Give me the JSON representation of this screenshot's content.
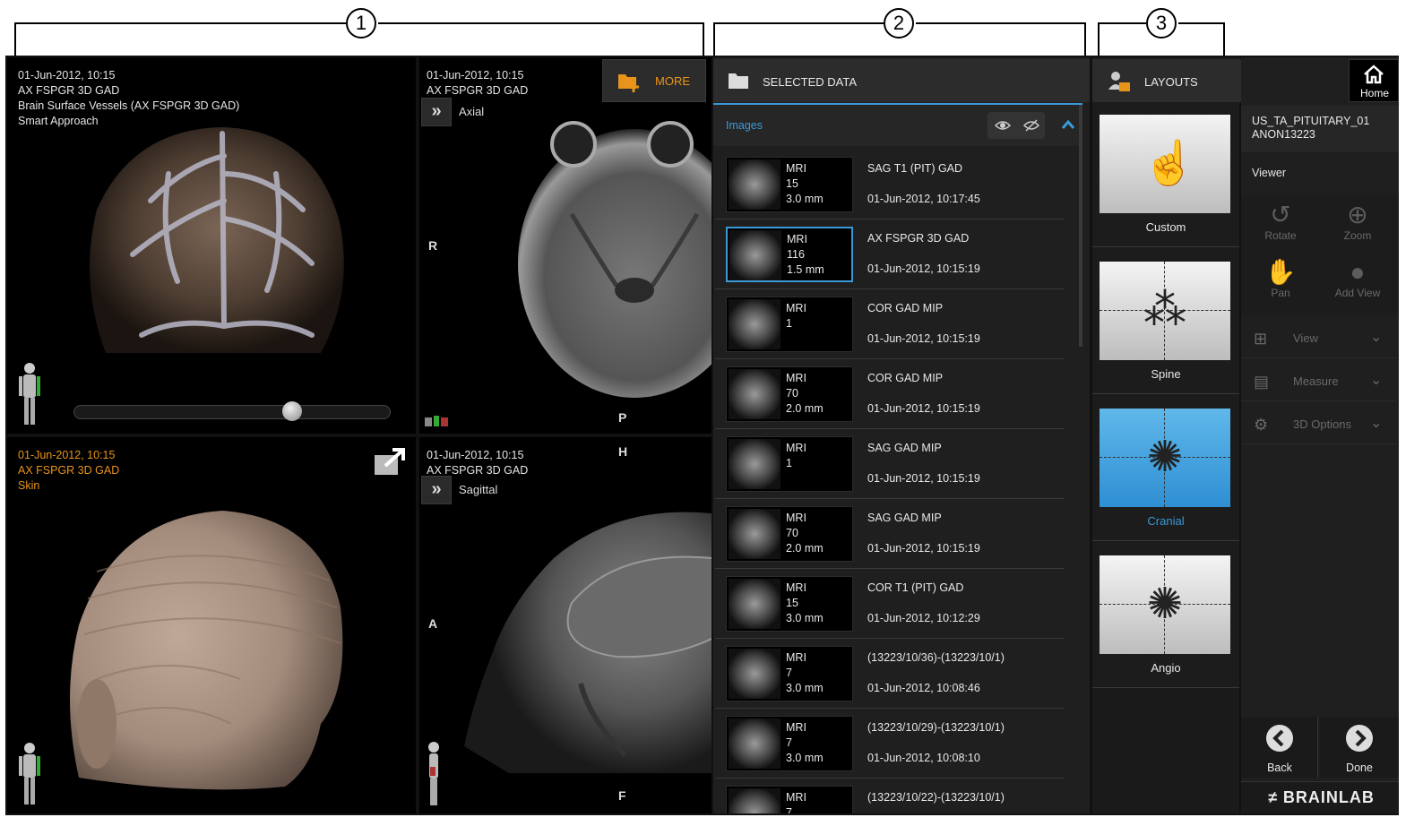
{
  "callouts": [
    "1",
    "2",
    "3"
  ],
  "viewports": {
    "top_left": {
      "date": "01-Jun-2012, 10:15",
      "series": "AX FSPGR 3D GAD",
      "object": "Brain Surface Vessels (AX FSPGR 3D GAD)",
      "mode": "Smart Approach",
      "slider_value": 0.7
    },
    "top_right": {
      "date": "01-Jun-2012, 10:15",
      "series": "AX FSPGR 3D GAD",
      "plane": "Axial",
      "orient_left": "R",
      "orient_bottom": "P",
      "more_label": "MORE"
    },
    "bottom_left": {
      "date": "01-Jun-2012, 10:15",
      "series": "AX FSPGR 3D GAD",
      "object": "Skin"
    },
    "bottom_right": {
      "date": "01-Jun-2012, 10:15",
      "series": "AX FSPGR 3D GAD",
      "plane": "Sagittal",
      "orient_top": "H",
      "orient_left": "A",
      "orient_bottom": "F"
    }
  },
  "selected_data": {
    "title": "SELECTED DATA",
    "section": "Images",
    "rows": [
      {
        "modality": "MRI",
        "count": "15",
        "thickness": "3.0 mm",
        "title": "SAG T1 (PIT) GAD",
        "date": "01-Jun-2012, 10:17:45"
      },
      {
        "modality": "MRI",
        "count": "116",
        "thickness": "1.5 mm",
        "title": "AX FSPGR 3D GAD",
        "date": "01-Jun-2012, 10:15:19"
      },
      {
        "modality": "MRI",
        "count": "1",
        "thickness": "",
        "title": "COR GAD MIP",
        "date": "01-Jun-2012, 10:15:19"
      },
      {
        "modality": "MRI",
        "count": "70",
        "thickness": "2.0 mm",
        "title": "COR GAD MIP",
        "date": "01-Jun-2012, 10:15:19"
      },
      {
        "modality": "MRI",
        "count": "1",
        "thickness": "",
        "title": "SAG GAD MIP",
        "date": "01-Jun-2012, 10:15:19"
      },
      {
        "modality": "MRI",
        "count": "70",
        "thickness": "2.0 mm",
        "title": "SAG GAD MIP",
        "date": "01-Jun-2012, 10:15:19"
      },
      {
        "modality": "MRI",
        "count": "15",
        "thickness": "3.0 mm",
        "title": "COR T1 (PIT) GAD",
        "date": "01-Jun-2012, 10:12:29"
      },
      {
        "modality": "MRI",
        "count": "7",
        "thickness": "3.0 mm",
        "title": "(13223/10/36)-(13223/10/1)",
        "date": "01-Jun-2012, 10:08:46"
      },
      {
        "modality": "MRI",
        "count": "7",
        "thickness": "3.0 mm",
        "title": "(13223/10/29)-(13223/10/1)",
        "date": "01-Jun-2012, 10:08:10"
      },
      {
        "modality": "MRI",
        "count": "7",
        "thickness": "",
        "title": "(13223/10/22)-(13223/10/1)",
        "date": ""
      }
    ]
  },
  "layouts": {
    "title": "LAYOUTS",
    "items": [
      {
        "label": "Custom"
      },
      {
        "label": "Spine"
      },
      {
        "label": "Cranial"
      },
      {
        "label": "Angio"
      }
    ]
  },
  "sidebar": {
    "home_label": "Home",
    "patient_id": "US_TA_PITUITARY_01",
    "patient_anon": "ANON13223",
    "mode": "Viewer",
    "tools": [
      {
        "label": "Rotate"
      },
      {
        "label": "Zoom"
      },
      {
        "label": "Pan"
      },
      {
        "label": "Add View"
      }
    ],
    "sections": [
      {
        "label": "View"
      },
      {
        "label": "Measure"
      },
      {
        "label": "3D Options"
      }
    ],
    "back_label": "Back",
    "done_label": "Done",
    "brand": "BRAINLAB"
  },
  "colors": {
    "accent_blue": "#3a9ad8",
    "accent_orange": "#e8941a",
    "panel_bg": "#1f1f1f"
  }
}
